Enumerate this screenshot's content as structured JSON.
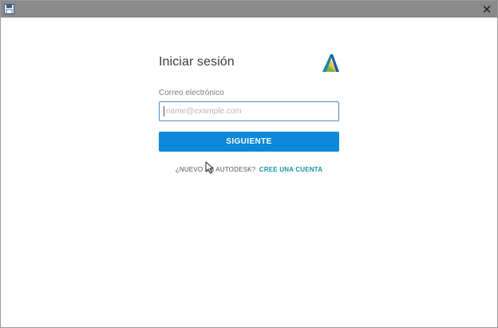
{
  "window": {
    "close_glyph": "✕",
    "app_icon": "floppy-disk-icon"
  },
  "login": {
    "title": "Iniciar sesión",
    "logo": "autodesk-logo-icon",
    "email_label": "Correo electrónico",
    "email_value": "",
    "email_placeholder": "name@example.com",
    "next_button_label": "SIGUIENTE",
    "signup_prompt": "¿NUEVO EN AUTODESK?",
    "signup_link": "CREE UNA CUENTA"
  },
  "colors": {
    "titlebar": "#8a8a8a",
    "primary_button": "#0e88d8",
    "link": "#1593a8",
    "input_border": "#4d8fc4"
  }
}
